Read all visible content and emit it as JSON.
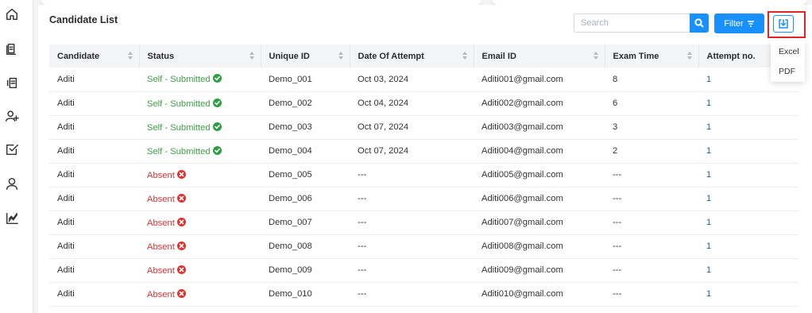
{
  "sidebar": {
    "icons": [
      "home-icon",
      "document-icon",
      "copy-icon",
      "add-user-icon",
      "checkbox-icon",
      "user-icon",
      "analytics-icon"
    ]
  },
  "main": {
    "title": "Candidate List",
    "search_placeholder": "Search",
    "filter_label": "Filter",
    "download_menu": [
      "Excel",
      "PDF"
    ]
  },
  "table": {
    "columns": [
      "Candidate",
      "Status",
      "Unique ID",
      "Date Of Attempt",
      "Email ID",
      "Exam Time",
      "Attempt no."
    ],
    "rows": [
      {
        "candidate": "Aditi",
        "status": "Self - Submitted",
        "status_type": "submitted",
        "unique_id": "Demo_001",
        "date": "Oct 03, 2024",
        "email": "Aditi001@gmail.com",
        "exam_time": "8",
        "attempt": "1"
      },
      {
        "candidate": "Aditi",
        "status": "Self - Submitted",
        "status_type": "submitted",
        "unique_id": "Demo_002",
        "date": "Oct 04, 2024",
        "email": "Aditi002@gmail.com",
        "exam_time": "6",
        "attempt": "1"
      },
      {
        "candidate": "Aditi",
        "status": "Self - Submitted",
        "status_type": "submitted",
        "unique_id": "Demo_003",
        "date": "Oct 07, 2024",
        "email": "Aditi003@gmail.com",
        "exam_time": "3",
        "attempt": "1"
      },
      {
        "candidate": "Aditi",
        "status": "Self - Submitted",
        "status_type": "submitted",
        "unique_id": "Demo_004",
        "date": "Oct 07, 2024",
        "email": "Aditi004@gmail.com",
        "exam_time": "2",
        "attempt": "1"
      },
      {
        "candidate": "Aditi",
        "status": "Absent",
        "status_type": "absent",
        "unique_id": "Demo_005",
        "date": "---",
        "email": "Aditi005@gmail.com",
        "exam_time": "---",
        "attempt": "1"
      },
      {
        "candidate": "Aditi",
        "status": "Absent",
        "status_type": "absent",
        "unique_id": "Demo_006",
        "date": "---",
        "email": "Aditi006@gmail.com",
        "exam_time": "---",
        "attempt": "1"
      },
      {
        "candidate": "Aditi",
        "status": "Absent",
        "status_type": "absent",
        "unique_id": "Demo_007",
        "date": "---",
        "email": "Aditi007@gmail.com",
        "exam_time": "---",
        "attempt": "1"
      },
      {
        "candidate": "Aditi",
        "status": "Absent",
        "status_type": "absent",
        "unique_id": "Demo_008",
        "date": "---",
        "email": "Aditi008@gmail.com",
        "exam_time": "---",
        "attempt": "1"
      },
      {
        "candidate": "Aditi",
        "status": "Absent",
        "status_type": "absent",
        "unique_id": "Demo_009",
        "date": "---",
        "email": "Aditi009@gmail.com",
        "exam_time": "---",
        "attempt": "1"
      },
      {
        "candidate": "Aditi",
        "status": "Absent",
        "status_type": "absent",
        "unique_id": "Demo_010",
        "date": "---",
        "email": "Aditi010@gmail.com",
        "exam_time": "---",
        "attempt": "1"
      }
    ]
  },
  "colors": {
    "accent": "#1890ff",
    "submitted": "#3ea044",
    "absent": "#e03131",
    "highlight": "#e0262a"
  }
}
